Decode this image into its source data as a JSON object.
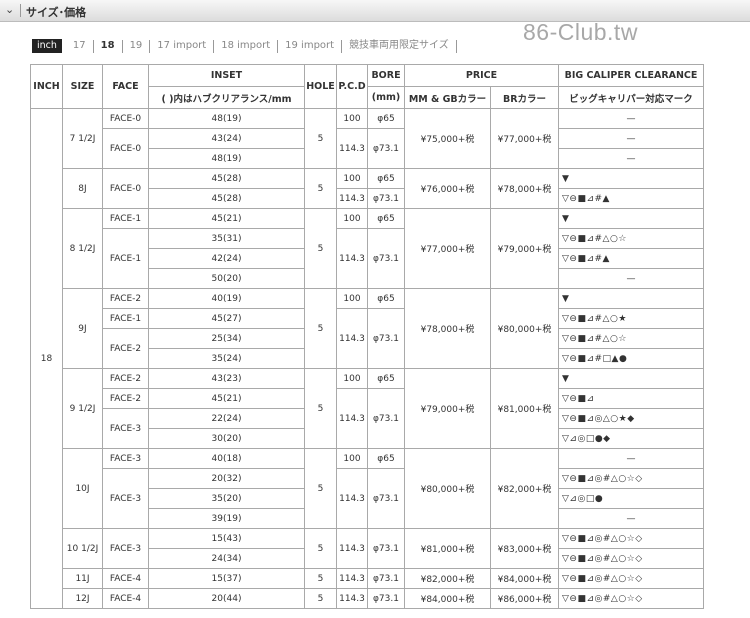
{
  "header": {
    "title": "サイズ･価格"
  },
  "tabs": [
    {
      "label": "inch",
      "active": true
    },
    {
      "label": "17"
    },
    {
      "label": "18",
      "bold": true
    },
    {
      "label": "19"
    },
    {
      "label": "17 import"
    },
    {
      "label": "18 import"
    },
    {
      "label": "19 import"
    },
    {
      "label": "競技車両用限定サイズ"
    }
  ],
  "watermark": "86-Club.tw",
  "table": {
    "headers": {
      "inch": "INCH",
      "size": "SIZE",
      "face": "FACE",
      "inset": "INSET",
      "inset_sub": "( )内はハブクリアランス/mm",
      "hole": "HOLE",
      "pcd": "P.C.D",
      "bore": "BORE",
      "bore_sub": "(mm)",
      "price": "PRICE",
      "price_mm": "MM & GBカラー",
      "price_br": "BRカラー",
      "clearance": "BIG CALIPER CLEARANCE",
      "clearance_sub": "ビッグキャリパー対応マーク"
    },
    "inch_value": "18",
    "groups": [
      {
        "size": "7 1/2J",
        "hole": "5",
        "price_mm": "¥75,000+税",
        "price_br": "¥77,000+税",
        "pcd_bore": [
          {
            "pcd": "100",
            "bore": "φ65",
            "rows": 1
          },
          {
            "pcd": "114.3",
            "bore": "φ73.1",
            "rows": 2
          }
        ],
        "faces": [
          {
            "label": "FACE-0",
            "rows": 1
          },
          {
            "label": "FACE-0",
            "rows": 2
          }
        ],
        "insets": [
          "48(19)",
          "43(24)",
          "48(19)"
        ],
        "marks": [
          {
            "text": "—",
            "rows": 1,
            "center": true
          },
          {
            "text": "—",
            "rows": 1,
            "center": true
          },
          {
            "text": "—",
            "rows": 1,
            "center": true
          }
        ]
      },
      {
        "size": "8J",
        "hole": "5",
        "price_mm": "¥76,000+税",
        "price_br": "¥78,000+税",
        "pcd_bore": [
          {
            "pcd": "100",
            "bore": "φ65",
            "rows": 1
          },
          {
            "pcd": "114.3",
            "bore": "φ73.1",
            "rows": 1
          }
        ],
        "faces": [
          {
            "label": "FACE-0",
            "rows": 2
          }
        ],
        "insets": [
          "45(28)",
          "45(28)"
        ],
        "marks": [
          {
            "text": "▼",
            "rows": 1
          },
          {
            "text": "▽⊖■⊿#▲",
            "rows": 1
          }
        ]
      },
      {
        "size": "8 1/2J",
        "hole": "5",
        "price_mm": "¥77,000+税",
        "price_br": "¥79,000+税",
        "pcd_bore": [
          {
            "pcd": "100",
            "bore": "φ65",
            "rows": 1
          },
          {
            "pcd": "114.3",
            "bore": "φ73.1",
            "rows": 3
          }
        ],
        "faces": [
          {
            "label": "FACE-1",
            "rows": 1
          },
          {
            "label": "FACE-1",
            "rows": 3
          }
        ],
        "insets": [
          "45(21)",
          "35(31)",
          "42(24)",
          "50(20)"
        ],
        "marks": [
          {
            "text": "▼",
            "rows": 1
          },
          {
            "text": "▽⊖■⊿#△○☆",
            "rows": 1
          },
          {
            "text": "▽⊖■⊿#▲",
            "rows": 1
          },
          {
            "text": "—",
            "rows": 1,
            "center": true
          }
        ]
      },
      {
        "size": "9J",
        "hole": "5",
        "price_mm": "¥78,000+税",
        "price_br": "¥80,000+税",
        "pcd_bore": [
          {
            "pcd": "100",
            "bore": "φ65",
            "rows": 1
          },
          {
            "pcd": "114.3",
            "bore": "φ73.1",
            "rows": 3
          }
        ],
        "faces": [
          {
            "label": "FACE-2",
            "rows": 1
          },
          {
            "label": "FACE-1",
            "rows": 1
          },
          {
            "label": "FACE-2",
            "rows": 2
          }
        ],
        "insets": [
          "40(19)",
          "45(27)",
          "25(34)",
          "35(24)"
        ],
        "marks": [
          {
            "text": "▼",
            "rows": 1
          },
          {
            "text": "▽⊖■⊿#△○★",
            "rows": 1
          },
          {
            "text": "▽⊖■⊿#△○☆",
            "rows": 1
          },
          {
            "text": "▽⊖■⊿#□▲●",
            "rows": 1
          }
        ]
      },
      {
        "size": "9 1/2J",
        "hole": "5",
        "price_mm": "¥79,000+税",
        "price_br": "¥81,000+税",
        "pcd_bore": [
          {
            "pcd": "100",
            "bore": "φ65",
            "rows": 1
          },
          {
            "pcd": "114.3",
            "bore": "φ73.1",
            "rows": 3
          }
        ],
        "faces": [
          {
            "label": "FACE-2",
            "rows": 1
          },
          {
            "label": "FACE-2",
            "rows": 1
          },
          {
            "label": "FACE-3",
            "rows": 2
          }
        ],
        "insets": [
          "43(23)",
          "45(21)",
          "22(24)",
          "30(20)"
        ],
        "marks": [
          {
            "text": "▼",
            "rows": 1
          },
          {
            "text": "▽⊖■⊿",
            "rows": 1
          },
          {
            "text": "▽⊖■⊿◎△○★◆",
            "rows": 1
          },
          {
            "text": "▽⊿◎□●◆",
            "rows": 1
          }
        ]
      },
      {
        "size": "10J",
        "hole": "5",
        "price_mm": "¥80,000+税",
        "price_br": "¥82,000+税",
        "pcd_bore": [
          {
            "pcd": "100",
            "bore": "φ65",
            "rows": 1
          },
          {
            "pcd": "114.3",
            "bore": "φ73.1",
            "rows": 3
          }
        ],
        "faces": [
          {
            "label": "FACE-3",
            "rows": 1
          },
          {
            "label": "FACE-3",
            "rows": 3
          }
        ],
        "insets": [
          "40(18)",
          "20(32)",
          "35(20)",
          "39(19)"
        ],
        "marks": [
          {
            "text": "—",
            "rows": 1,
            "center": true
          },
          {
            "text": "▽⊖■⊿◎#△○☆◇",
            "rows": 1
          },
          {
            "text": "▽⊿◎□●",
            "rows": 1
          },
          {
            "text": "—",
            "rows": 1,
            "center": true
          }
        ]
      },
      {
        "size": "10 1/2J",
        "hole": "5",
        "price_mm": "¥81,000+税",
        "price_br": "¥83,000+税",
        "pcd_bore": [
          {
            "pcd": "114.3",
            "bore": "φ73.1",
            "rows": 2
          }
        ],
        "faces": [
          {
            "label": "FACE-3",
            "rows": 2
          }
        ],
        "insets": [
          "15(43)",
          "24(34)"
        ],
        "marks": [
          {
            "text": "▽⊖■⊿◎#△○☆◇",
            "rows": 1
          },
          {
            "text": "▽⊖■⊿◎#△○☆◇",
            "rows": 1
          }
        ]
      },
      {
        "size": "11J",
        "hole": "5",
        "price_mm": "¥82,000+税",
        "price_br": "¥84,000+税",
        "pcd_bore": [
          {
            "pcd": "114.3",
            "bore": "φ73.1",
            "rows": 1
          }
        ],
        "faces": [
          {
            "label": "FACE-4",
            "rows": 1
          }
        ],
        "insets": [
          "15(37)"
        ],
        "marks": [
          {
            "text": "▽⊖■⊿◎#△○☆◇",
            "rows": 1
          }
        ]
      },
      {
        "size": "12J",
        "hole": "5",
        "price_mm": "¥84,000+税",
        "price_br": "¥86,000+税",
        "pcd_bore": [
          {
            "pcd": "114.3",
            "bore": "φ73.1",
            "rows": 1
          }
        ],
        "faces": [
          {
            "label": "FACE-4",
            "rows": 1
          }
        ],
        "insets": [
          "20(44)"
        ],
        "marks": [
          {
            "text": "▽⊖■⊿◎#△○☆◇",
            "rows": 1
          }
        ]
      }
    ]
  }
}
